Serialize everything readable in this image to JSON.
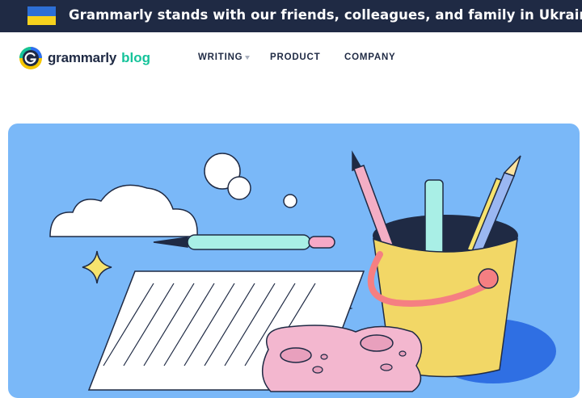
{
  "banner": {
    "text": "Grammarly stands with our friends, colleagues, and family in Ukraine, and",
    "flag_colors": [
      "#2d6fd6",
      "#f7d21d"
    ]
  },
  "header": {
    "logo_word": "grammarly",
    "logo_blog": "blog",
    "nav": {
      "writing": "WRITING",
      "product": "PRODUCT",
      "company": "COMPANY"
    }
  },
  "hero": {
    "illustration": "writing-supplies-illustration"
  },
  "colors": {
    "banner_bg": "#1f2a44",
    "brand_green": "#15c39a",
    "hero_bg": "#7ab8f8"
  }
}
